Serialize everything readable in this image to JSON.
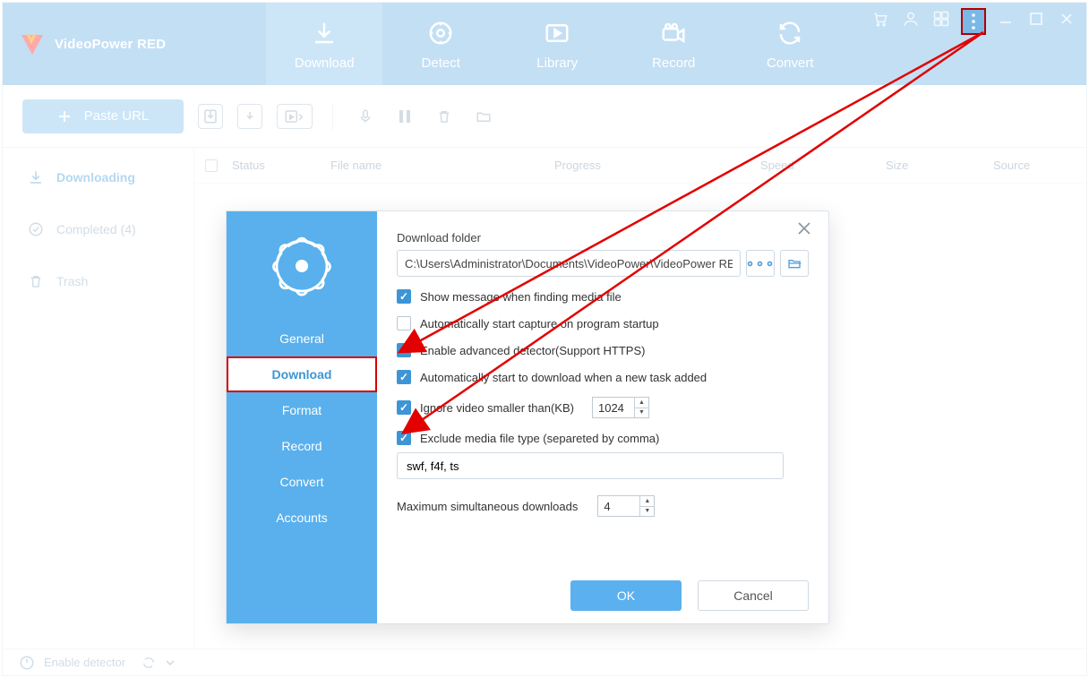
{
  "app_title": "VideoPower RED",
  "tabs": {
    "download": "Download",
    "detect": "Detect",
    "library": "Library",
    "record": "Record",
    "convert": "Convert"
  },
  "toolbar": {
    "paste_label": "Paste URL"
  },
  "sidebar": {
    "items": [
      {
        "label": "Downloading"
      },
      {
        "label": "Completed (4)"
      },
      {
        "label": "Trash"
      }
    ]
  },
  "list_headers": {
    "status": "Status",
    "filename": "File name",
    "progress": "Progress",
    "speed": "Speed",
    "size": "Size",
    "source": "Source"
  },
  "footer": {
    "enable_detector": "Enable detector"
  },
  "settings": {
    "side": {
      "general": "General",
      "download": "Download",
      "format": "Format",
      "record": "Record",
      "convert": "Convert",
      "accounts": "Accounts"
    },
    "download_folder_label": "Download folder",
    "download_folder_value": "C:\\Users\\Administrator\\Documents\\VideoPower\\VideoPower RED\\",
    "opt_show_msg": "Show message when finding media file",
    "opt_auto_capture": "Automatically start capture on program startup",
    "opt_adv_detector": "Enable advanced detector(Support HTTPS)",
    "opt_auto_dl": "Automatically start to download when a new task added",
    "opt_ignore_kb": "Ignore video smaller than(KB)",
    "ignore_kb_value": "1024",
    "opt_exclude": "Exclude media file type (separeted by comma)",
    "exclude_value": "swf, f4f, ts",
    "max_sim_label": "Maximum simultaneous downloads",
    "max_sim_value": "4",
    "btn_ok": "OK",
    "btn_cancel": "Cancel"
  }
}
